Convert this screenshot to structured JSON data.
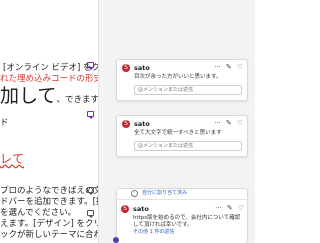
{
  "document": {
    "line1": "[オンライン ビデオ] をク",
    "line2": "れた埋め込みコードの形式",
    "line3": "加して",
    "line3b": "、できます。",
    "line3c": "キ",
    "line4": "ド",
    "line5": "レて",
    "line6": "プロのようなできばえの文",
    "line7": "ドバーを追加できます。[挿",
    "line8": "を選んでください。",
    "line9": "えます。[デザイン] をクリ",
    "line10": "ックが新しいテーマに合わ"
  },
  "comments": [
    {
      "avatar": "S",
      "author": "sato",
      "text": "目次が余った方がいいと思います。",
      "reply_placeholder": "@メンションまたは返信"
    },
    {
      "avatar": "S",
      "author": "sato",
      "text": "全て大文字で統一すべきと思います",
      "reply_placeholder": "@メンションまたは返信"
    },
    {
      "avatar": "S",
      "author": "sato",
      "text": "https版を始めるので、会社内について確認して頂ければ幸いです。",
      "reply_placeholder": "",
      "link": "その他 1 件の返信"
    }
  ],
  "resolve_label": "自分に割り当て済み",
  "actions": {
    "more": "···",
    "edit": "✎",
    "like": "♡"
  },
  "colors": {
    "avatar": "#c4262e",
    "marker": "#8a1fbf",
    "accent": "#2b62c4"
  }
}
